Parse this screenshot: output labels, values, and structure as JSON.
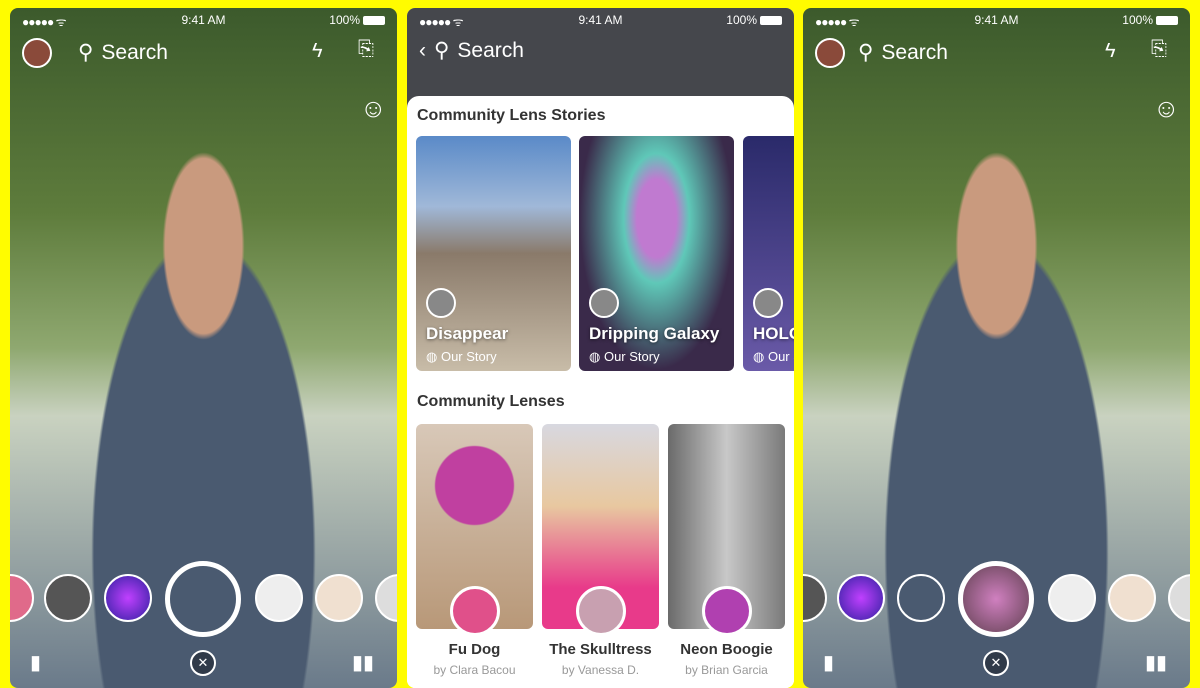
{
  "status": {
    "signal": "●●●●● ᯤ",
    "time": "9:41 AM",
    "battery": "100%"
  },
  "camera": {
    "search_label": "Search"
  },
  "middle": {
    "search_label": "Search",
    "stories_title": "Community Lens Stories",
    "stories": [
      {
        "title": "Disappear",
        "subtitle": "Our Story"
      },
      {
        "title": "Dripping Galaxy",
        "subtitle": "Our Story"
      },
      {
        "title": "HOLO",
        "subtitle": "Our Story"
      }
    ],
    "lenses_title": "Community Lenses",
    "lenses": [
      {
        "name": "Fu Dog",
        "author": "by Clara Bacou"
      },
      {
        "name": "The Skulltress",
        "author": "by Vanessa D."
      },
      {
        "name": "Neon Boogie",
        "author": "by Brian Garcia"
      }
    ]
  },
  "colors": {
    "background": "#fffc00",
    "header": "#45474c"
  }
}
